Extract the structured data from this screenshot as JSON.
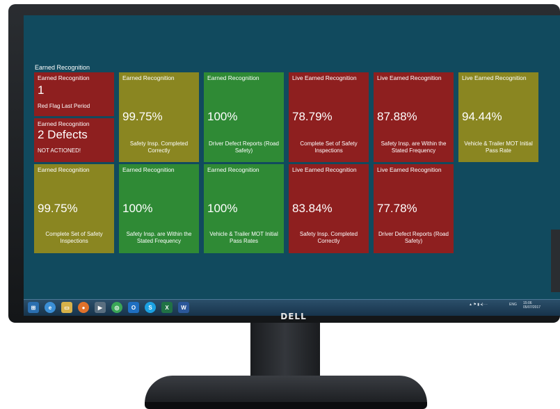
{
  "brand": "DELL",
  "dashboard": {
    "title": "Earned Recognition",
    "tiles": [
      {
        "header": "Earned Recognition",
        "value": "1",
        "caption": "Red Flag Last Period",
        "color": "#8e1f1f"
      },
      {
        "header": "Earned Recognition",
        "value": "2 Defects",
        "caption": "NOT ACTIONED!",
        "color": "#8e1f1f"
      },
      {
        "header": "Earned Recognition",
        "value": "99.75%",
        "caption": "Safety Insp. Completed Correctly",
        "color": "#8a8621"
      },
      {
        "header": "Earned Recognition",
        "value": "100%",
        "caption": "Driver Defect Reports (Road Safety)",
        "color": "#2f8a35"
      },
      {
        "header": "Live Earned Recognition",
        "value": "78.79%",
        "caption": "Complete Set of Safety Inspections",
        "color": "#8e1f1f"
      },
      {
        "header": "Live Earned Recognition",
        "value": "87.88%",
        "caption": "Safety Insp. are Within the Stated Frequency",
        "color": "#8e1f1f"
      },
      {
        "header": "Live Earned Recognition",
        "value": "94.44%",
        "caption": "Vehicle & Trailer MOT Initial Pass Rate",
        "color": "#8a8621"
      },
      {
        "header": "Earned Recognition",
        "value": "99.75%",
        "caption": "Complete Set of Safety Inspections",
        "color": "#8a8621"
      },
      {
        "header": "Earned Recognition",
        "value": "100%",
        "caption": "Safety Insp. are Within the Stated Frequency",
        "color": "#2f8a35"
      },
      {
        "header": "Earned Recognition",
        "value": "100%",
        "caption": "Vehicle & Trailer MOT Initial Pass Rates",
        "color": "#2f8a35"
      },
      {
        "header": "Live Earned Recognition",
        "value": "83.84%",
        "caption": "Safety Insp. Completed Correctly",
        "color": "#8e1f1f"
      },
      {
        "header": "Live Earned Recognition",
        "value": "77.78%",
        "caption": "Driver Defect Reports (Road Safety)",
        "color": "#8e1f1f"
      }
    ]
  },
  "taskbar": {
    "apps": [
      "start-icon",
      "ie-icon",
      "explorer-icon",
      "firefox-icon",
      "media-icon",
      "chrome-icon",
      "outlook-icon",
      "skype-icon",
      "excel-icon",
      "word-icon"
    ],
    "tray_lang": "ENG",
    "tray_time": "15:06",
    "tray_date": "05/07/2017"
  }
}
